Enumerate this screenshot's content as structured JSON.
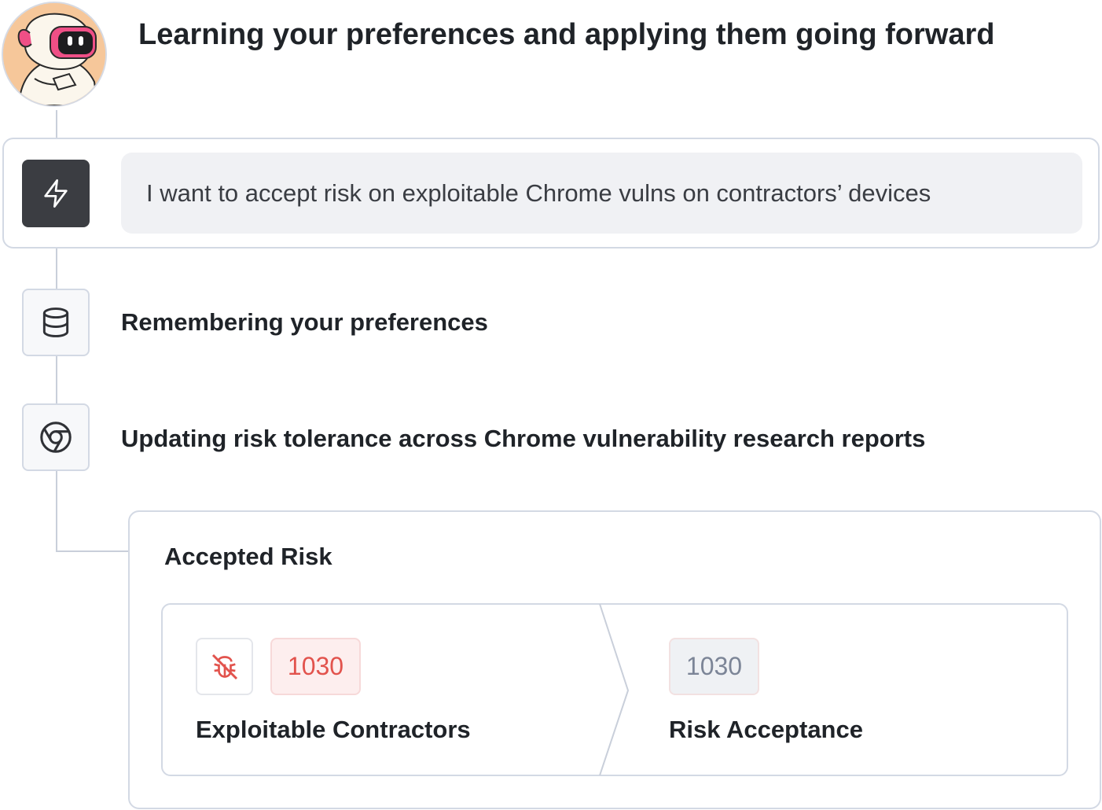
{
  "header": {
    "title": "Learning your preferences and applying them going forward"
  },
  "prompt": {
    "text": "I want to accept risk on exploitable Chrome vulns on contractors’ devices",
    "icon": "bolt-icon"
  },
  "steps": [
    {
      "label": "Remembering your preferences",
      "icon": "database-icon"
    },
    {
      "label": "Updating risk tolerance across Chrome vulnerability research reports",
      "icon": "chrome-icon"
    }
  ],
  "accepted_risk": {
    "title": "Accepted Risk",
    "from": {
      "count": "1030",
      "label": "Exploitable Contractors",
      "icon": "bug-off-icon"
    },
    "to": {
      "count": "1030",
      "label": "Risk Acceptance"
    }
  },
  "colors": {
    "accent_red": "#e2534d",
    "badge_red_bg": "#fdeeee",
    "border": "#d3d9e4",
    "dark_icon_bg": "#3b3d42"
  }
}
